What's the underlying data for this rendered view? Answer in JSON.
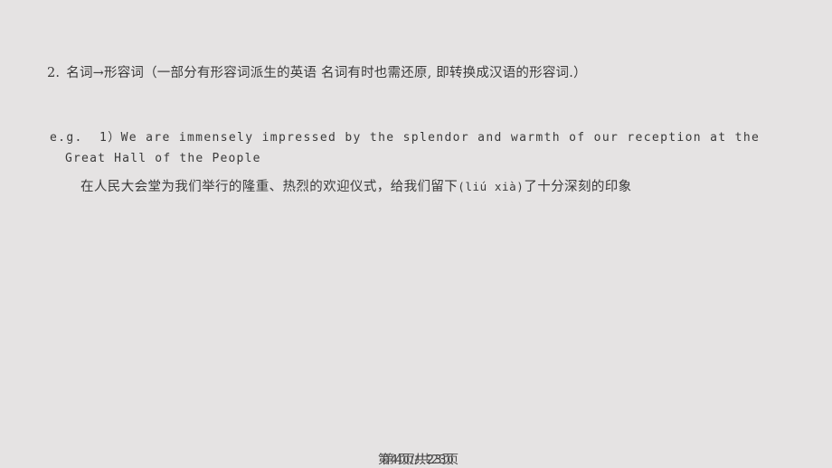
{
  "slide": {
    "background_color": "#e5e3e3",
    "text_color": "#3a3a3a"
  },
  "heading": {
    "number": "2.",
    "text": "名词→形容词（一部分有形容词派生的英语 名词有时也需还原, 即转换成汉语的形容词.）"
  },
  "example": {
    "english_line_1": "e.g.  1）We are immensely impressed by the splendor and warmth of our reception at the",
    "english_line_2": "Great Hall of the People",
    "chinese_prefix": "在人民大会堂为我们举行的隆重、热烈的欢迎仪式，给我们留下",
    "chinese_pinyin": "(liú xià)",
    "chinese_suffix": "了十分深刻的印象"
  },
  "footer": {
    "page_indicator": "第4页/共23页",
    "current_page": "4",
    "total_pages": "23"
  }
}
